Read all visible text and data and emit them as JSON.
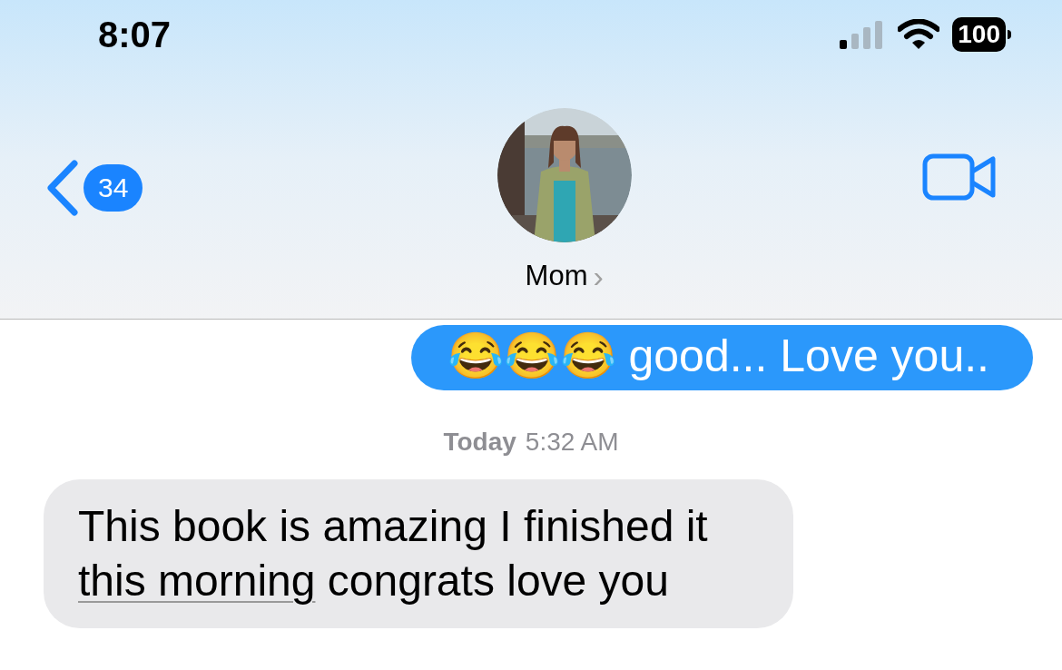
{
  "status_bar": {
    "time": "8:07",
    "battery": "100"
  },
  "header": {
    "back_count": "34",
    "contact_name": "Mom",
    "chevron": "›"
  },
  "messages": [
    {
      "kind": "sent",
      "text": "😂😂😂 good... Love you.."
    },
    {
      "kind": "timestamp",
      "day": "Today",
      "time": "5:32 AM"
    },
    {
      "kind": "received",
      "parts": [
        {
          "text": "This book is amazing I finished it",
          "link": false
        },
        {
          "text": "this morning",
          "link": true
        },
        {
          "text": " congrats love you",
          "link": false
        }
      ]
    }
  ]
}
